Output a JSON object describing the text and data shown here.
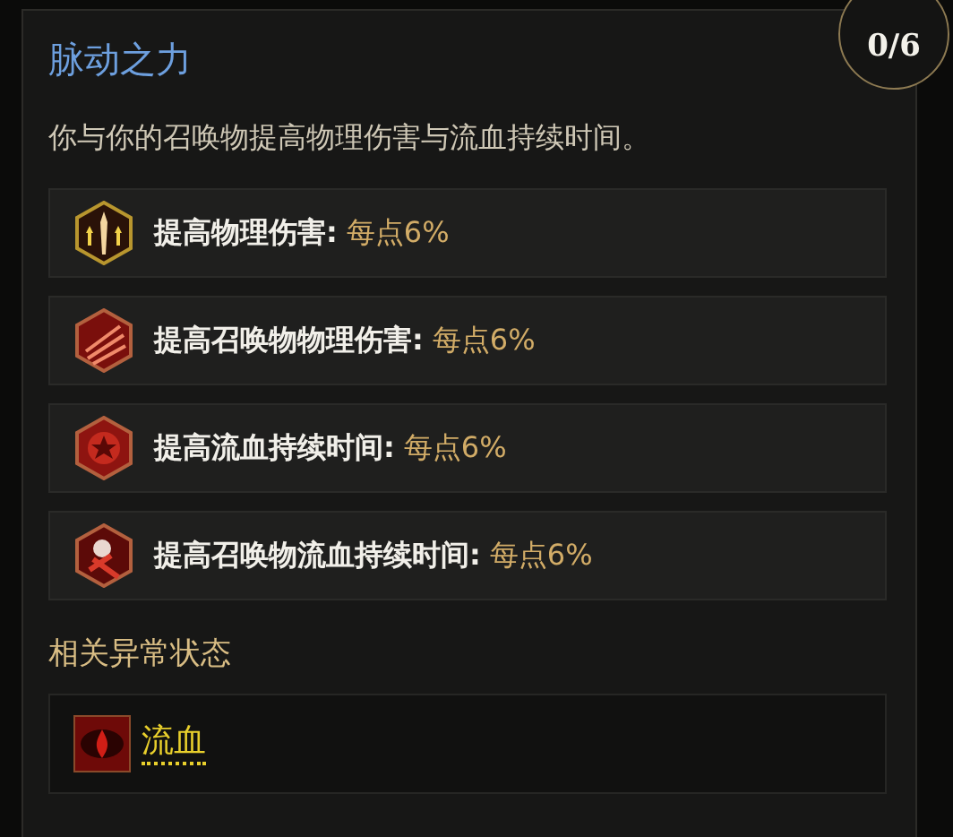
{
  "panel": {
    "title": "脉动之力",
    "points": "0/6",
    "description": "你与你的召唤物提高物理伤害与流血持续时间。"
  },
  "effects": [
    {
      "label": "提高物理伤害:",
      "value": "每点6%"
    },
    {
      "label": "提高召唤物物理伤害:",
      "value": "每点6%"
    },
    {
      "label": "提高流血持续时间:",
      "value": "每点6%"
    },
    {
      "label": "提高召唤物流血持续时间:",
      "value": "每点6%"
    }
  ],
  "related": {
    "heading": "相关异常状态",
    "items": [
      {
        "label": "流血"
      }
    ]
  }
}
